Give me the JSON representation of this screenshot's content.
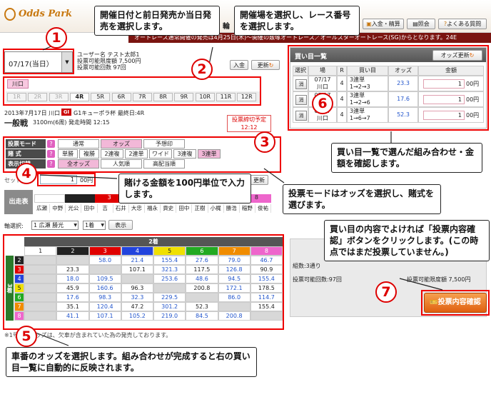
{
  "header": {
    "logo": "Odds Park",
    "nav_partial": "輪",
    "buttons": {
      "deposit": "入金・精算",
      "inquiry": "照会",
      "faq": "よくある質問"
    },
    "ticker": "オートレース通常開催の発売は4月25日(木)〜開催の飯塚オートレース／オールスターオートレース(SG)からとなります。24E"
  },
  "date_select": {
    "value": "07/17(当日）"
  },
  "user": {
    "name_line": "ユーザー名  テスト太郎1",
    "limit_line": "投票可能限度額  7,500円",
    "count_line": "投票可能回数  97回",
    "deposit_btn": "入金",
    "refresh_btn": "更新"
  },
  "venue": {
    "tab": "川口"
  },
  "races": [
    "1R",
    "2R",
    "3R",
    "4R",
    "5R",
    "6R",
    "7R",
    "8R",
    "9R",
    "10R",
    "11R",
    "12R"
  ],
  "race_info": {
    "date_line": "2013年7月17日  川口",
    "grade": "GI",
    "race_name": "G1キューポラ杯  最終日:4R",
    "race_type": "一般戦",
    "detail": "3100m(6周)  発走時間 12:15",
    "deadline_label": "投票締切予定",
    "deadline_time": "12:12"
  },
  "modes": {
    "vote_mode_label": "投票モード",
    "vote_modes": [
      "通常",
      "オッズ",
      "予想印"
    ],
    "bet_type_label": "賭  式",
    "bet_types": [
      "単勝",
      "複勝",
      "2連複",
      "2連単",
      "ワイド",
      "3連複",
      "3連単"
    ],
    "display_label": "表示切替",
    "display_modes": [
      "全オッズ",
      "人気順",
      "高配当順"
    ]
  },
  "amount": {
    "label": "セット金額",
    "value": "1",
    "unit": "00円",
    "refresh": "更新"
  },
  "entries": {
    "label": "出走表",
    "riders": [
      "広瀬",
      "中野",
      "光公",
      "田中",
      "吉",
      "石井",
      "大忠",
      "福永",
      "貢史",
      "田中",
      "正樹",
      "小梶",
      "勝浩",
      "稲野",
      "俊祐"
    ]
  },
  "axis_select": {
    "label": "軸選択:",
    "rider": "1 広瀬  勝光",
    "position": "1着",
    "show_btn": "表示"
  },
  "odds_table": {
    "header_label": "2着",
    "side_label": "3着",
    "cols": [
      "1",
      "2",
      "3",
      "4",
      "5",
      "6",
      "7",
      "8"
    ],
    "col_colors": [
      "#ffffff",
      "#222222",
      "#e00000",
      "#2244dd",
      "#f0e000",
      "#22aa22",
      "#f08c00",
      "#ee66cc"
    ],
    "rows": [
      {
        "num": "2",
        "color": "#222222",
        "cells": [
          "",
          "",
          "58.0",
          "21.4",
          "155.4",
          "27.6",
          "79.0",
          "46.7"
        ]
      },
      {
        "num": "3",
        "color": "#e00000",
        "cells": [
          "",
          "23.3",
          "",
          "107.1",
          "321.3",
          "117.5",
          "126.8",
          "90.9"
        ]
      },
      {
        "num": "4",
        "color": "#2244dd",
        "cells": [
          "",
          "18.0",
          "109.5",
          "",
          "253.6",
          "48.6",
          "94.5",
          "155.4"
        ]
      },
      {
        "num": "5",
        "color": "#f0e000",
        "cells": [
          "",
          "45.9",
          "160.6",
          "96.3",
          "",
          "200.8",
          "172.1",
          "178.5"
        ]
      },
      {
        "num": "6",
        "color": "#22aa22",
        "cells": [
          "",
          "17.6",
          "98.3",
          "32.3",
          "229.5",
          "",
          "86.0",
          "114.7"
        ]
      },
      {
        "num": "7",
        "color": "#f08c00",
        "cells": [
          "",
          "35.1",
          "120.4",
          "47.2",
          "301.2",
          "52.3",
          "",
          "155.4"
        ]
      },
      {
        "num": "8",
        "color": "#ee66cc",
        "cells": [
          "",
          "41.1",
          "107.1",
          "105.2",
          "219.0",
          "84.5",
          "200.8",
          ""
        ]
      }
    ],
    "footnote": "※1号車のオッズは、欠車が含まれていた為の発売しております。"
  },
  "ticket_list": {
    "title": "買い目一覧",
    "odds_refresh": "オッズ更新",
    "headers": [
      "選択",
      "場",
      "R",
      "買い目",
      "オッズ",
      "金額"
    ],
    "rows": [
      {
        "del": "消",
        "date": "07/17",
        "venue": "川口",
        "race": "4",
        "type": "3連単",
        "combo": "1→2→3",
        "odds": "23.3",
        "amount": "1",
        "unit": "00円"
      },
      {
        "del": "消",
        "date": "07/17",
        "venue": "川口",
        "race": "4",
        "type": "3連単",
        "combo": "1→2→6",
        "odds": "17.6",
        "amount": "1",
        "unit": "00円"
      },
      {
        "del": "消",
        "date": "07/17",
        "venue": "川口",
        "race": "4",
        "type": "3連単",
        "combo": "1→6→7",
        "odds": "52.3",
        "amount": "1",
        "unit": "00円"
      }
    ]
  },
  "summary": {
    "count_line": "組数:3通り",
    "remain_line": "投票可能回数:97回",
    "limit_line": "投票可能限度額  7,500円",
    "confirm_btn": "投票内容確認"
  },
  "callouts": {
    "c1": "開催日付と前日発売か当日発売を選択します。",
    "c2": "開催場を選択し、レース番号を選択します。",
    "c3": "投票モードはオッズを選択し、賭式を選びます。",
    "c4": "賭ける金額を100円単位で入力します。",
    "c5": "車番のオッズを選択します。組み合わせが完成すると右の買い目一覧に自動的に反映されます。",
    "c6": "買い目一覧で選んだ組み合わせ・金額を確認します。",
    "c7": "買い目の内容でよければ「投票内容確認」ボタンをクリックします。(この時点ではまだ投票していません。)"
  },
  "numbers": [
    "1",
    "2",
    "3",
    "4",
    "5",
    "6",
    "7"
  ]
}
